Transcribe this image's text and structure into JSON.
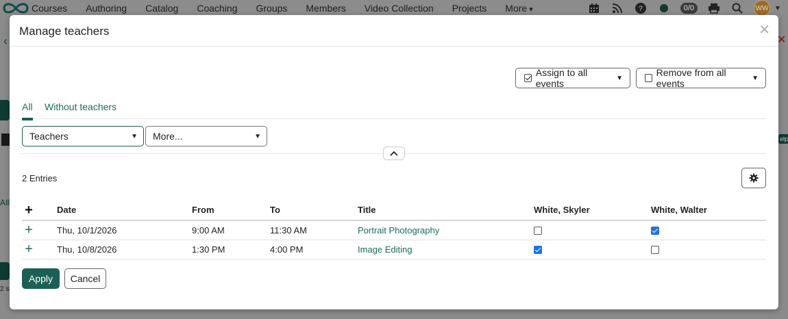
{
  "nav": {
    "items": [
      "Courses",
      "Authoring",
      "Catalog",
      "Coaching",
      "Groups",
      "Members",
      "Video Collection",
      "Projects"
    ],
    "more_label": "More",
    "counter": "0/0",
    "avatar_initials": "WW"
  },
  "background": {
    "help_fragment": "elp",
    "all_fragment": "All",
    "count_fragment": "2 s"
  },
  "modal": {
    "title": "Manage teachers",
    "assign_label": "Assign to all events",
    "remove_label": "Remove from all events",
    "tabs": [
      {
        "label": "All",
        "active": true
      },
      {
        "label": "Without teachers",
        "active": false
      }
    ],
    "filters": {
      "teachers_label": "Teachers",
      "more_label": "More..."
    },
    "entries_label": "2 Entries",
    "table": {
      "headers": [
        "Date",
        "From",
        "To",
        "Title",
        "White, Skyler",
        "White, Walter"
      ],
      "rows": [
        {
          "date": "Thu, 10/1/2026",
          "from": "9:00 AM",
          "to": "11:30 AM",
          "title": "Portrait Photography",
          "skyler": false,
          "walter": true
        },
        {
          "date": "Thu, 10/8/2026",
          "from": "1:30 PM",
          "to": "4:00 PM",
          "title": "Image Editing",
          "skyler": true,
          "walter": false
        }
      ]
    },
    "apply_label": "Apply",
    "cancel_label": "Cancel"
  },
  "colors": {
    "accent": "#1b5f55",
    "link": "#1b6b5e",
    "checkbox_checked": "#1a73e8"
  }
}
